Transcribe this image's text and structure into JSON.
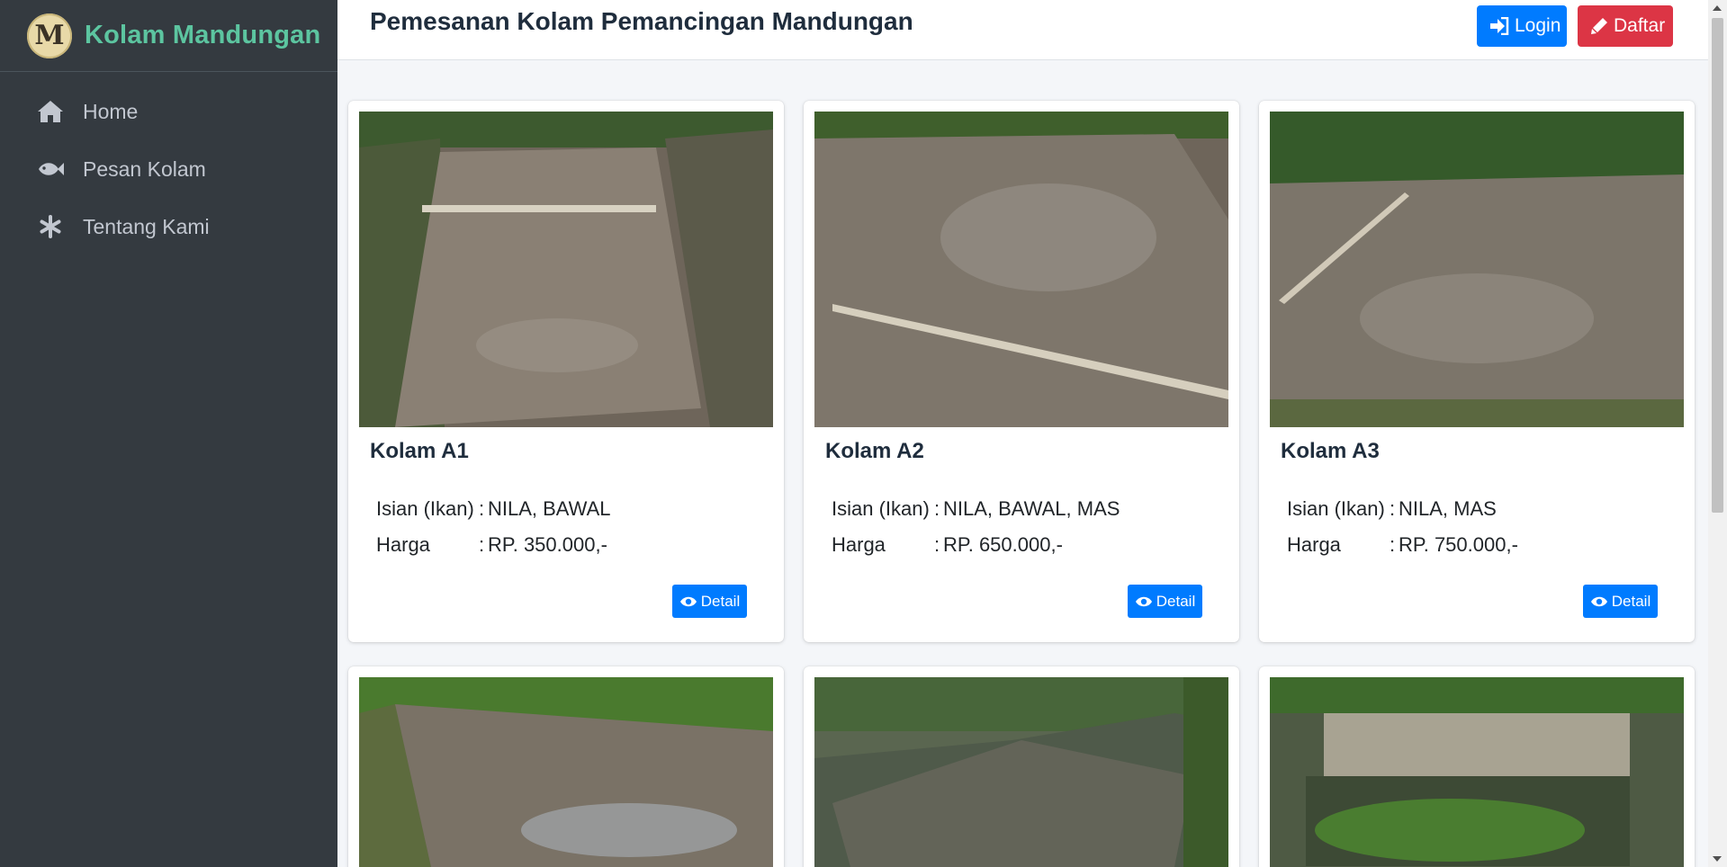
{
  "brand": {
    "logo_letter": "M",
    "name": "Kolam Mandungan"
  },
  "sidebar": {
    "items": [
      {
        "label": "Home",
        "icon": "home-icon"
      },
      {
        "label": "Pesan Kolam",
        "icon": "fish-icon"
      },
      {
        "label": "Tentang Kami",
        "icon": "asterisk-icon"
      }
    ]
  },
  "header": {
    "title": "Pemesanan Kolam Pemancingan Mandungan",
    "login_label": "Login",
    "daftar_label": "Daftar"
  },
  "cards": [
    {
      "title": "Kolam A1",
      "isian_label": "Isian (Ikan)",
      "isian_value": "NILA, BAWAL",
      "harga_label": "Harga",
      "harga_value": "RP. 350.000,-",
      "detail_label": "Detail"
    },
    {
      "title": "Kolam A2",
      "isian_label": "Isian (Ikan)",
      "isian_value": "NILA, BAWAL, MAS",
      "harga_label": "Harga",
      "harga_value": "RP. 650.000,-",
      "detail_label": "Detail"
    },
    {
      "title": "Kolam A3",
      "isian_label": "Isian (Ikan)",
      "isian_value": "NILA, MAS",
      "harga_label": "Harga",
      "harga_value": "RP. 750.000,-",
      "detail_label": "Detail"
    }
  ],
  "separator": ":",
  "colors": {
    "sidebar_bg": "#343a40",
    "brand_text": "#5cc5a0",
    "primary": "#007bff",
    "danger": "#dc3545",
    "content_bg": "#f4f6f9"
  }
}
